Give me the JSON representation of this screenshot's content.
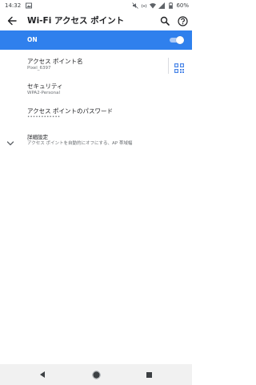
{
  "status_bar": {
    "time": "14:32",
    "battery": "60%"
  },
  "app_bar": {
    "title": "Wi-Fi アクセス ポイント",
    "icons": [
      "back-arrow-icon",
      "search-icon",
      "help-icon"
    ]
  },
  "toggle": {
    "label": "ON",
    "state": "on",
    "accent_color": "#2f80ed"
  },
  "settings": {
    "ap_name": {
      "title": "アクセス ポイント名",
      "value": "Pixel_6397"
    },
    "security": {
      "title": "セキュリティ",
      "value": "WPA2-Personal"
    },
    "password": {
      "title": "アクセス ポイントのパスワード",
      "value": "••••••••••••"
    },
    "advanced": {
      "title": "詳細設定",
      "value": "アクセス ポイントを自動的にオフにする、AP 帯域幅"
    }
  },
  "nav_bar": {
    "icons": [
      "back-triangle-icon",
      "home-circle-icon",
      "recents-square-icon"
    ]
  }
}
